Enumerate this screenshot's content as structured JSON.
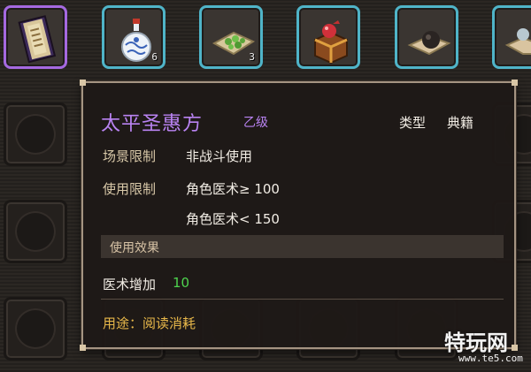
{
  "inventory": {
    "top_row": [
      {
        "name": "book",
        "selected": true,
        "count": ""
      },
      {
        "name": "porcelain-vase",
        "count": "6"
      },
      {
        "name": "herb-leaf",
        "count": "3"
      },
      {
        "name": "treasure-box",
        "count": ""
      },
      {
        "name": "black-pill",
        "count": ""
      },
      {
        "name": "partial-item",
        "count": ""
      }
    ]
  },
  "tooltip": {
    "name": "太平圣惠方",
    "grade": "乙级",
    "type_label": "类型",
    "type_value": "典籍",
    "scene_label": "场景限制",
    "scene_value": "非战斗使用",
    "use_label": "使用限制",
    "use_req_1": "角色医术≥ 100",
    "use_req_2": "角色医术< 150",
    "effect_section": "使用效果",
    "effect_label": "医术增加",
    "effect_value": "10",
    "usage": "用途：阅读消耗"
  },
  "watermark": {
    "text": "特玩网",
    "url": "www.te5.com"
  },
  "colors": {
    "name_purple": "#b983f2",
    "effect_green": "#4ed34e",
    "usage_gold": "#e8b84a",
    "slot_cyan": "#4fb4c8"
  }
}
